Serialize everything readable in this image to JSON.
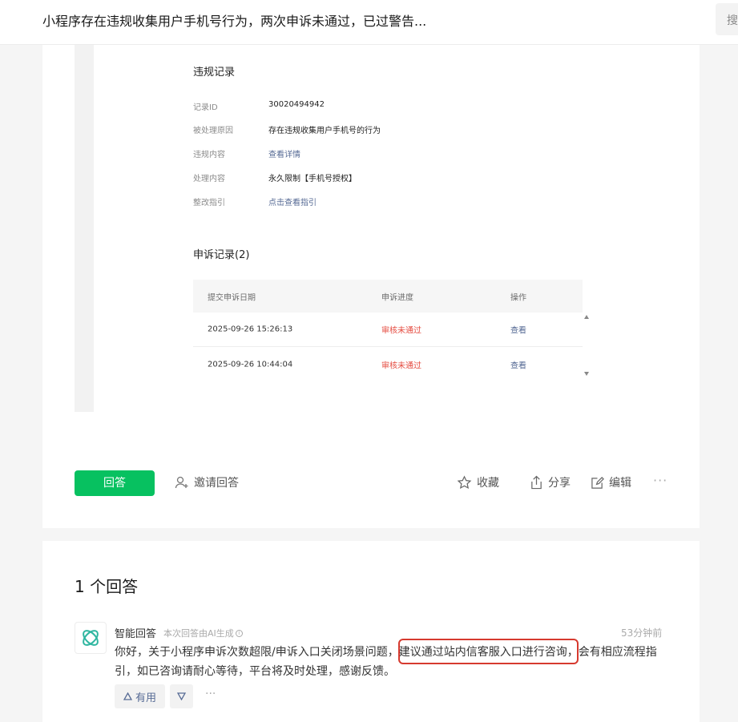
{
  "header": {
    "title": "小程序存在违规收集用户手机号行为，两次申诉未通过，已过警告...",
    "search_glyph": "搜"
  },
  "violation": {
    "title": "违规记录",
    "rows": [
      {
        "label": "记录ID",
        "value": "30020494942"
      },
      {
        "label": "被处理原因",
        "value": "存在违规收集用户手机号的行为"
      },
      {
        "label": "违规内容",
        "value": "查看详情"
      },
      {
        "label": "处理内容",
        "value": "永久限制【手机号授权】"
      },
      {
        "label": "整改指引",
        "value": "点击查看指引"
      }
    ]
  },
  "appeals": {
    "title": "申诉记录(2)",
    "columns": [
      "提交申诉日期",
      "申诉进度",
      "操作"
    ],
    "rows": [
      {
        "date": "2025-09-26 15:26:13",
        "status": "审核未通过",
        "action": "查看"
      },
      {
        "date": "2025-09-26 10:44:04",
        "status": "审核未通过",
        "action": "查看"
      }
    ]
  },
  "actions": {
    "answer": "回答",
    "invite": "邀请回答",
    "favorite": "收藏",
    "share": "分享",
    "edit": "编辑",
    "more": "···"
  },
  "answers": {
    "count_label": "1 个回答",
    "items": [
      {
        "author": "智能回答",
        "note": "本次回答由AI生成",
        "time": "53分钟前",
        "body_before": "你好，关于小程序申诉次数超限/申诉入口关闭场景问题，",
        "body_highlight": "建议通过站内信客服入口进行咨询，",
        "body_after": "会有相应流程指引，如已咨询请耐心等待，平台将及时处理，感谢反馈。",
        "useful_label": "有用",
        "more": "···"
      }
    ]
  },
  "colors": {
    "brand_green": "#07c160",
    "link_blue": "#576b95",
    "status_red": "#e54d42",
    "highlight_red": "#d63a2f"
  }
}
